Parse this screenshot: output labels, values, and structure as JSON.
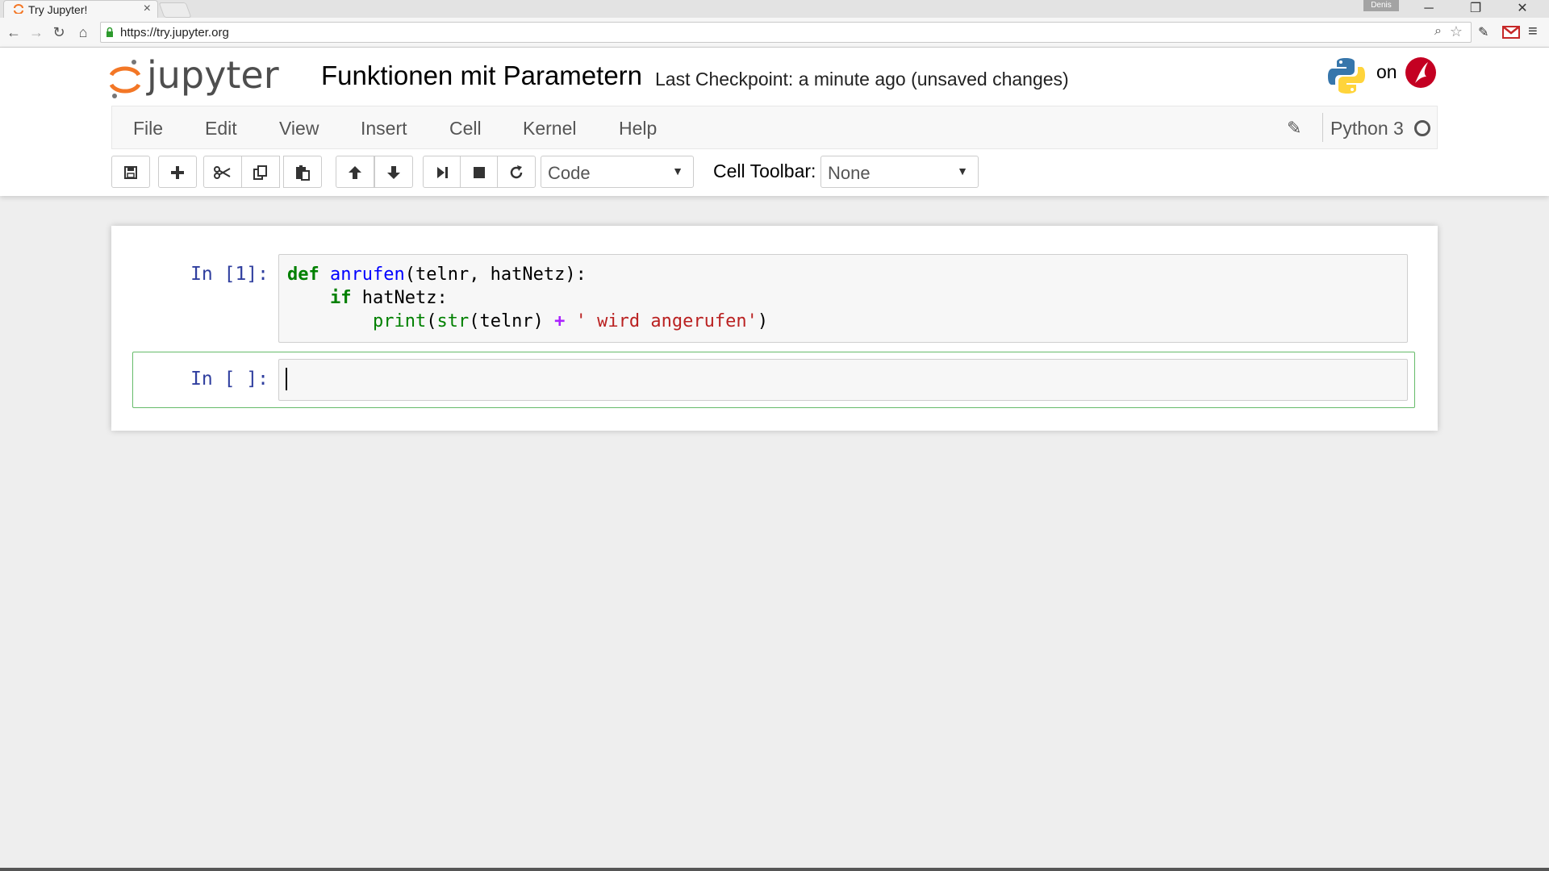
{
  "browser": {
    "tab_title": "Try Jupyter!",
    "tab_close": "×",
    "profile_name": "Denis",
    "url": "https://try.jupyter.org",
    "window_controls": {
      "minimize": "─",
      "maximize": "❐",
      "close": "✕"
    },
    "nav": {
      "back": "←",
      "forward": "→",
      "reload": "↻",
      "home": "⌂"
    }
  },
  "header": {
    "logo_text": "jupyter",
    "notebook_title": "Funktionen mit Parametern",
    "checkpoint": "Last Checkpoint: a minute ago (unsaved changes)",
    "on_text": "on"
  },
  "menubar": {
    "items": [
      "File",
      "Edit",
      "View",
      "Insert",
      "Cell",
      "Kernel",
      "Help"
    ],
    "kernel_name": "Python 3"
  },
  "toolbar": {
    "cell_type": "Code",
    "cell_toolbar_label": "Cell Toolbar:",
    "cell_toolbar_value": "None",
    "caret": "▼"
  },
  "cells": [
    {
      "prompt": "In [1]:",
      "code": "def anrufen(telnr, hatNetz):\n    if hatNetz:\n        print(str(telnr) + ' wird angerufen')"
    },
    {
      "prompt": "In [ ]:",
      "code": ""
    }
  ],
  "colors": {
    "jupyter_orange": "#f37726",
    "prompt_blue": "#303f9f",
    "selected_cell_border": "#66bb6a"
  }
}
